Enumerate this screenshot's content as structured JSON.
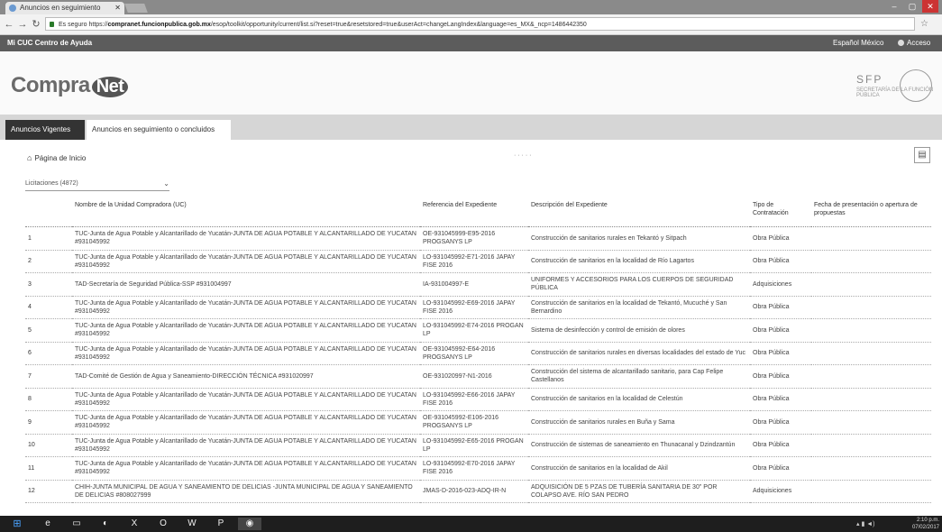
{
  "browser": {
    "tab_title": "Anuncios en seguimiento",
    "url_scheme": "https://",
    "url_host": "compranet.funcionpublica.gob.mx",
    "url_rest": "/esop/toolkit/opportunity/current/list.si?reset=true&resetstored=true&userAct=changeLangIndex&language=es_MX&_ncp=1486442350",
    "secure_label": "Es seguro"
  },
  "site": {
    "topbar_left": "Mi CUC Centro de Ayuda",
    "topbar_right1": "Español México",
    "topbar_right2": "Acceso",
    "logo_text": "Compra",
    "logo_circle": "Net",
    "sfp": "SFP",
    "sfp_sub": "SECRETARÍA DE LA FUNCIÓN PÚBLICA"
  },
  "tabs": [
    {
      "label": "Anuncios Vigentes"
    },
    {
      "label": "Anuncios en seguimiento o concluidos"
    }
  ],
  "content": {
    "home_link": "Página de Inicio",
    "mid_text": "· · · · ·",
    "select_value": "Licitaciones (4872)"
  },
  "table": {
    "headers": [
      "",
      "Nombre de la Unidad Compradora (UC)",
      "Referencia del Expediente",
      "Descripción del Expediente",
      "Tipo de Contratación",
      "Fecha de presentación o apertura de propuestas"
    ],
    "rows": [
      [
        "1",
        "TUC-Junta de Agua Potable y Alcantarillado de Yucatán-JUNTA DE AGUA POTABLE Y ALCANTARILLADO DE YUCATAN #931045992",
        "OE-931045999-E95-2016 PROGSANYS LP",
        "Construcción de sanitarios rurales en Tekantó y Sitpach",
        "Obra Pública",
        ""
      ],
      [
        "2",
        "TUC-Junta de Agua Potable y Alcantarillado de Yucatán-JUNTA DE AGUA POTABLE Y ALCANTARILLADO DE YUCATAN #931045992",
        "LO-931045992-E71-2016 JAPAY FISE 2016",
        "Construcción de sanitarios en la localidad de Río Lagartos",
        "Obra Pública",
        ""
      ],
      [
        "3",
        "TAD-Secretaría de Seguridad Pública-SSP #931004997",
        "IA-931004997-E",
        "UNIFORMES Y ACCESORIOS PARA LOS CUERPOS DE SEGURIDAD PÚBLICA",
        "Adquisiciones",
        ""
      ],
      [
        "4",
        "TUC-Junta de Agua Potable y Alcantarillado de Yucatán-JUNTA DE AGUA POTABLE Y ALCANTARILLADO DE YUCATAN #931045992",
        "LO-931045992-E69-2016 JAPAY FISE 2016",
        "Construcción de sanitarios en la localidad de Tekantó, Mucuché y San Bernardino",
        "Obra Pública",
        ""
      ],
      [
        "5",
        "TUC-Junta de Agua Potable y Alcantarillado de Yucatán-JUNTA DE AGUA POTABLE Y ALCANTARILLADO DE YUCATAN #931045992",
        "LO-931045992-E74-2016 PROGAN LP",
        "Sistema de desinfección y control de emisión de olores",
        "Obra Pública",
        ""
      ],
      [
        "6",
        "TUC-Junta de Agua Potable y Alcantarillado de Yucatán-JUNTA DE AGUA POTABLE Y ALCANTARILLADO DE YUCATAN #931045992",
        "OE-931045992-E64-2016 PROGSANYS LP",
        "Construcción de sanitarios rurales en diversas localidades del estado de Yuc",
        "Obra Pública",
        ""
      ],
      [
        "7",
        "TAD-Comité de Gestión de Agua y Saneamiento-DIRECCIÓN TÉCNICA #931020997",
        "OE-931020997-N1-2016",
        "Construcción del sistema de alcantarillado sanitario, para Cap Felipe Castellanos",
        "Obra Pública",
        ""
      ],
      [
        "8",
        "TUC-Junta de Agua Potable y Alcantarillado de Yucatán-JUNTA DE AGUA POTABLE Y ALCANTARILLADO DE YUCATAN #931045992",
        "LO-931045992-E66-2016 JAPAY FISE 2016",
        "Construcción de sanitarios en la localidad de Celestún",
        "Obra Pública",
        ""
      ],
      [
        "9",
        "TUC-Junta de Agua Potable y Alcantarillado de Yucatán-JUNTA DE AGUA POTABLE Y ALCANTARILLADO DE YUCATAN #931045992",
        "OE-931045992-E106-2016 PROGSANYS LP",
        "Construcción de sanitarios rurales en Buña y Sama",
        "Obra Pública",
        ""
      ],
      [
        "10",
        "TUC-Junta de Agua Potable y Alcantarillado de Yucatán-JUNTA DE AGUA POTABLE Y ALCANTARILLADO DE YUCATAN #931045992",
        "LO-931045992-E65-2016 PROGAN LP",
        "Construcción de sistemas de saneamiento en Thunacanal y Dzindzantún",
        "Obra Pública",
        ""
      ],
      [
        "11",
        "TUC-Junta de Agua Potable y Alcantarillado de Yucatán-JUNTA DE AGUA POTABLE Y ALCANTARILLADO DE YUCATAN #931045992",
        "LO-931045992-E70-2016 JAPAY FISE 2016",
        "Construcción de sanitarios en la localidad de Akil",
        "Obra Pública",
        ""
      ],
      [
        "12",
        "CHIH-JUNTA MUNICIPAL DE AGUA Y SANEAMIENTO DE DELICIAS -JUNTA MUNICIPAL DE AGUA Y SANEAMIENTO DE DELICIAS #808027999",
        "JMAS-D-2016-023-ADQ-IR-N",
        "ADQUISICIÓN DE 5 PZAS DE TUBERÍA SANITARIA DE 30\" POR COLAPSO AVE. RÍO SAN PEDRO",
        "Adquisiciones",
        ""
      ]
    ]
  },
  "taskbar": {
    "clock_time": "2:10 p.m.",
    "clock_date": "07/02/2017"
  },
  "colors": {
    "topbar": "#5c5c5c",
    "active_tab": "#333333",
    "taskbar": "#1e1e1e"
  }
}
